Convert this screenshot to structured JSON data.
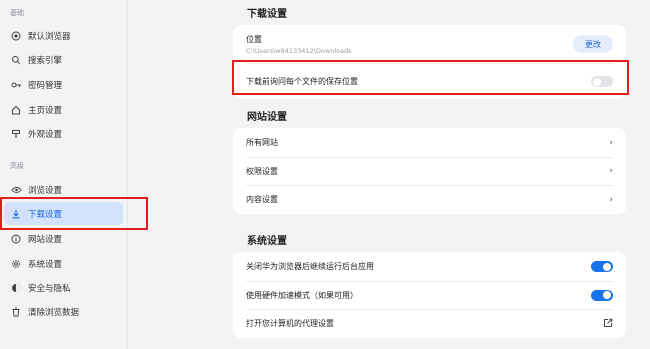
{
  "sidebar": {
    "section_basic": "基础",
    "section_advanced": "高级",
    "items": [
      {
        "label": "默认浏览器",
        "icon": "default-browser-icon"
      },
      {
        "label": "搜索引擎",
        "icon": "search-icon"
      },
      {
        "label": "密码管理",
        "icon": "key-icon"
      },
      {
        "label": "主页设置",
        "icon": "home-icon"
      },
      {
        "label": "外观设置",
        "icon": "appearance-icon"
      },
      {
        "label": "浏览设置",
        "icon": "eye-icon"
      },
      {
        "label": "下载设置",
        "icon": "download-icon",
        "active": true
      },
      {
        "label": "网站设置",
        "icon": "info-icon"
      },
      {
        "label": "系统设置",
        "icon": "gear-icon"
      },
      {
        "label": "安全与隐私",
        "icon": "shield-icon"
      },
      {
        "label": "清除浏览数据",
        "icon": "trash-icon"
      }
    ]
  },
  "download": {
    "heading": "下载设置",
    "location_label": "位置",
    "location_path": "C:\\Users\\w84133412\\Downloads",
    "change_button": "更改",
    "ask_label": "下载前询问每个文件的保存位置",
    "ask_enabled": false
  },
  "sites": {
    "heading": "网站设置",
    "rows": [
      "所有网站",
      "权限设置",
      "内容设置"
    ]
  },
  "system": {
    "heading": "系统设置",
    "background_label": "关闭华为浏览器后继续运行后台应用",
    "background_enabled": true,
    "hw_accel_label": "使用硬件加速模式（如果可用）",
    "hw_accel_enabled": true,
    "proxy_label": "打开您计算机的代理设置"
  },
  "colors": {
    "accent": "#1a73e8",
    "highlight": "#e0201b",
    "active_bg": "#d3e2fb"
  }
}
